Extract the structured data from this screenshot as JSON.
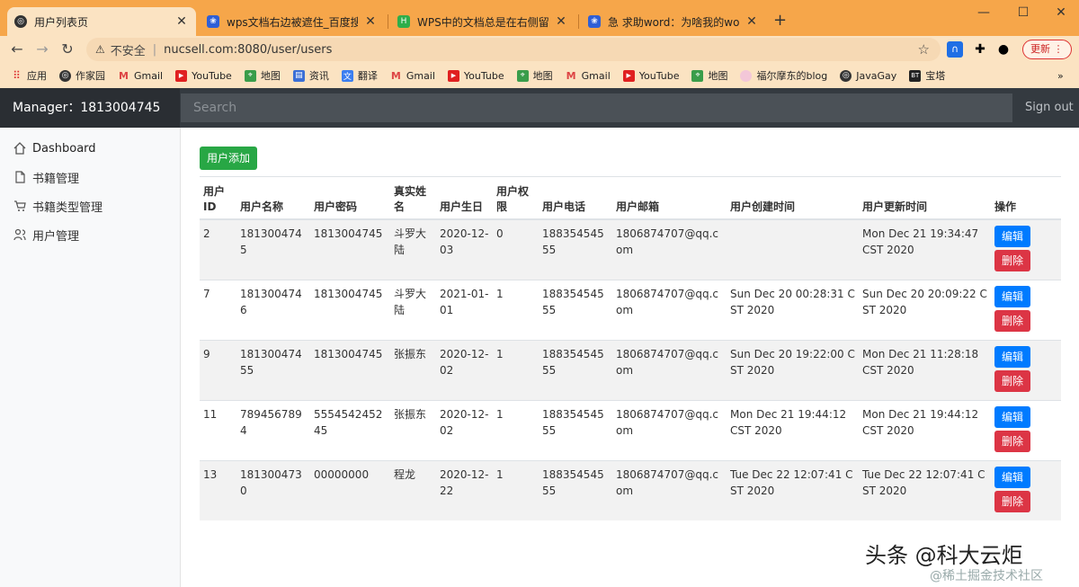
{
  "browser": {
    "tabs": [
      {
        "title": "用户列表页",
        "icon": "globe-icon",
        "active": true
      },
      {
        "title": "wps文档右边被遮住_百度搜索",
        "icon": "baidu-paw-icon",
        "active": false
      },
      {
        "title": "WPS中的文档总是在右侧留下空",
        "icon": "green-doc-icon",
        "active": false
      },
      {
        "title": "急 求助word：为啥我的word打",
        "icon": "baidu-paw-icon",
        "active": false
      }
    ],
    "address": {
      "security": "不安全",
      "url": "nucsell.com:8080/user/users"
    },
    "update_label": "更新",
    "bookmarks": [
      {
        "label": "应用",
        "icon": "apps-grid-icon"
      },
      {
        "label": "作家园",
        "icon": "globe-icon"
      },
      {
        "label": "Gmail",
        "icon": "gmail-icon"
      },
      {
        "label": "YouTube",
        "icon": "youtube-icon"
      },
      {
        "label": "地图",
        "icon": "maps-icon"
      },
      {
        "label": "资讯",
        "icon": "news-icon"
      },
      {
        "label": "翻译",
        "icon": "translate-icon"
      },
      {
        "label": "Gmail",
        "icon": "gmail-icon"
      },
      {
        "label": "YouTube",
        "icon": "youtube-icon"
      },
      {
        "label": "地图",
        "icon": "maps-icon"
      },
      {
        "label": "Gmail",
        "icon": "gmail-icon"
      },
      {
        "label": "YouTube",
        "icon": "youtube-icon"
      },
      {
        "label": "地图",
        "icon": "maps-icon"
      },
      {
        "label": "福尔摩东的blog",
        "icon": "blog-icon"
      },
      {
        "label": "JavaGay",
        "icon": "globe-icon"
      },
      {
        "label": "宝塔",
        "icon": "bt-icon"
      }
    ]
  },
  "header": {
    "brand": "Manager：1813004745",
    "search_placeholder": "Search",
    "signout": "Sign out"
  },
  "sidebar": {
    "items": [
      {
        "label": "Dashboard",
        "icon": "home-icon"
      },
      {
        "label": "书籍管理",
        "icon": "file-icon"
      },
      {
        "label": "书籍类型管理",
        "icon": "cart-icon"
      },
      {
        "label": "用户管理",
        "icon": "users-icon"
      }
    ]
  },
  "main": {
    "add_button": "用户添加",
    "columns": [
      "用户ID",
      "用户名称",
      "用户密码",
      "真实姓名",
      "用户生日",
      "用户权限",
      "用户电话",
      "用户邮箱",
      "用户创建时间",
      "用户更新时间",
      "操作"
    ],
    "edit_label": "编辑",
    "delete_label": "删除",
    "rows": [
      [
        "2",
        "1813004745",
        "1813004745",
        "斗罗大陆",
        "2020-12-03",
        "0",
        "18835454555",
        "1806874707@qq.com",
        "",
        "Mon Dec 21 19:34:47 CST 2020"
      ],
      [
        "7",
        "1813004746",
        "1813004745",
        "斗罗大陆",
        "2021-01-01",
        "1",
        "18835454555",
        "1806874707@qq.com",
        "Sun Dec 20 00:28:31 CST 2020",
        "Sun Dec 20 20:09:22 CST 2020"
      ],
      [
        "9",
        "18130047455",
        "1813004745",
        "张振东",
        "2020-12-02",
        "1",
        "18835454555",
        "1806874707@qq.com",
        "Sun Dec 20 19:22:00 CST 2020",
        "Mon Dec 21 11:28:18 CST 2020"
      ],
      [
        "11",
        "7894567894",
        "555454245245",
        "张振东",
        "2020-12-02",
        "1",
        "18835454555",
        "1806874707@qq.com",
        "Mon Dec 21 19:44:12 CST 2020",
        "Mon Dec 21 19:44:12 CST 2020"
      ],
      [
        "13",
        "1813004730",
        "00000000",
        "程龙",
        "2020-12-22",
        "1",
        "18835454555",
        "1806874707@qq.com",
        "Tue Dec 22 12:07:41 CST 2020",
        "Tue Dec 22 12:07:41 CST 2020"
      ]
    ]
  },
  "watermark": {
    "line1": "头条 @科大云炬",
    "line2": "@稀土掘金技术社区"
  },
  "colors": {
    "tabbar": "#f6a64a",
    "appbar": "#343a40",
    "add": "#28a745",
    "edit": "#007bff",
    "delete": "#dc3545"
  }
}
